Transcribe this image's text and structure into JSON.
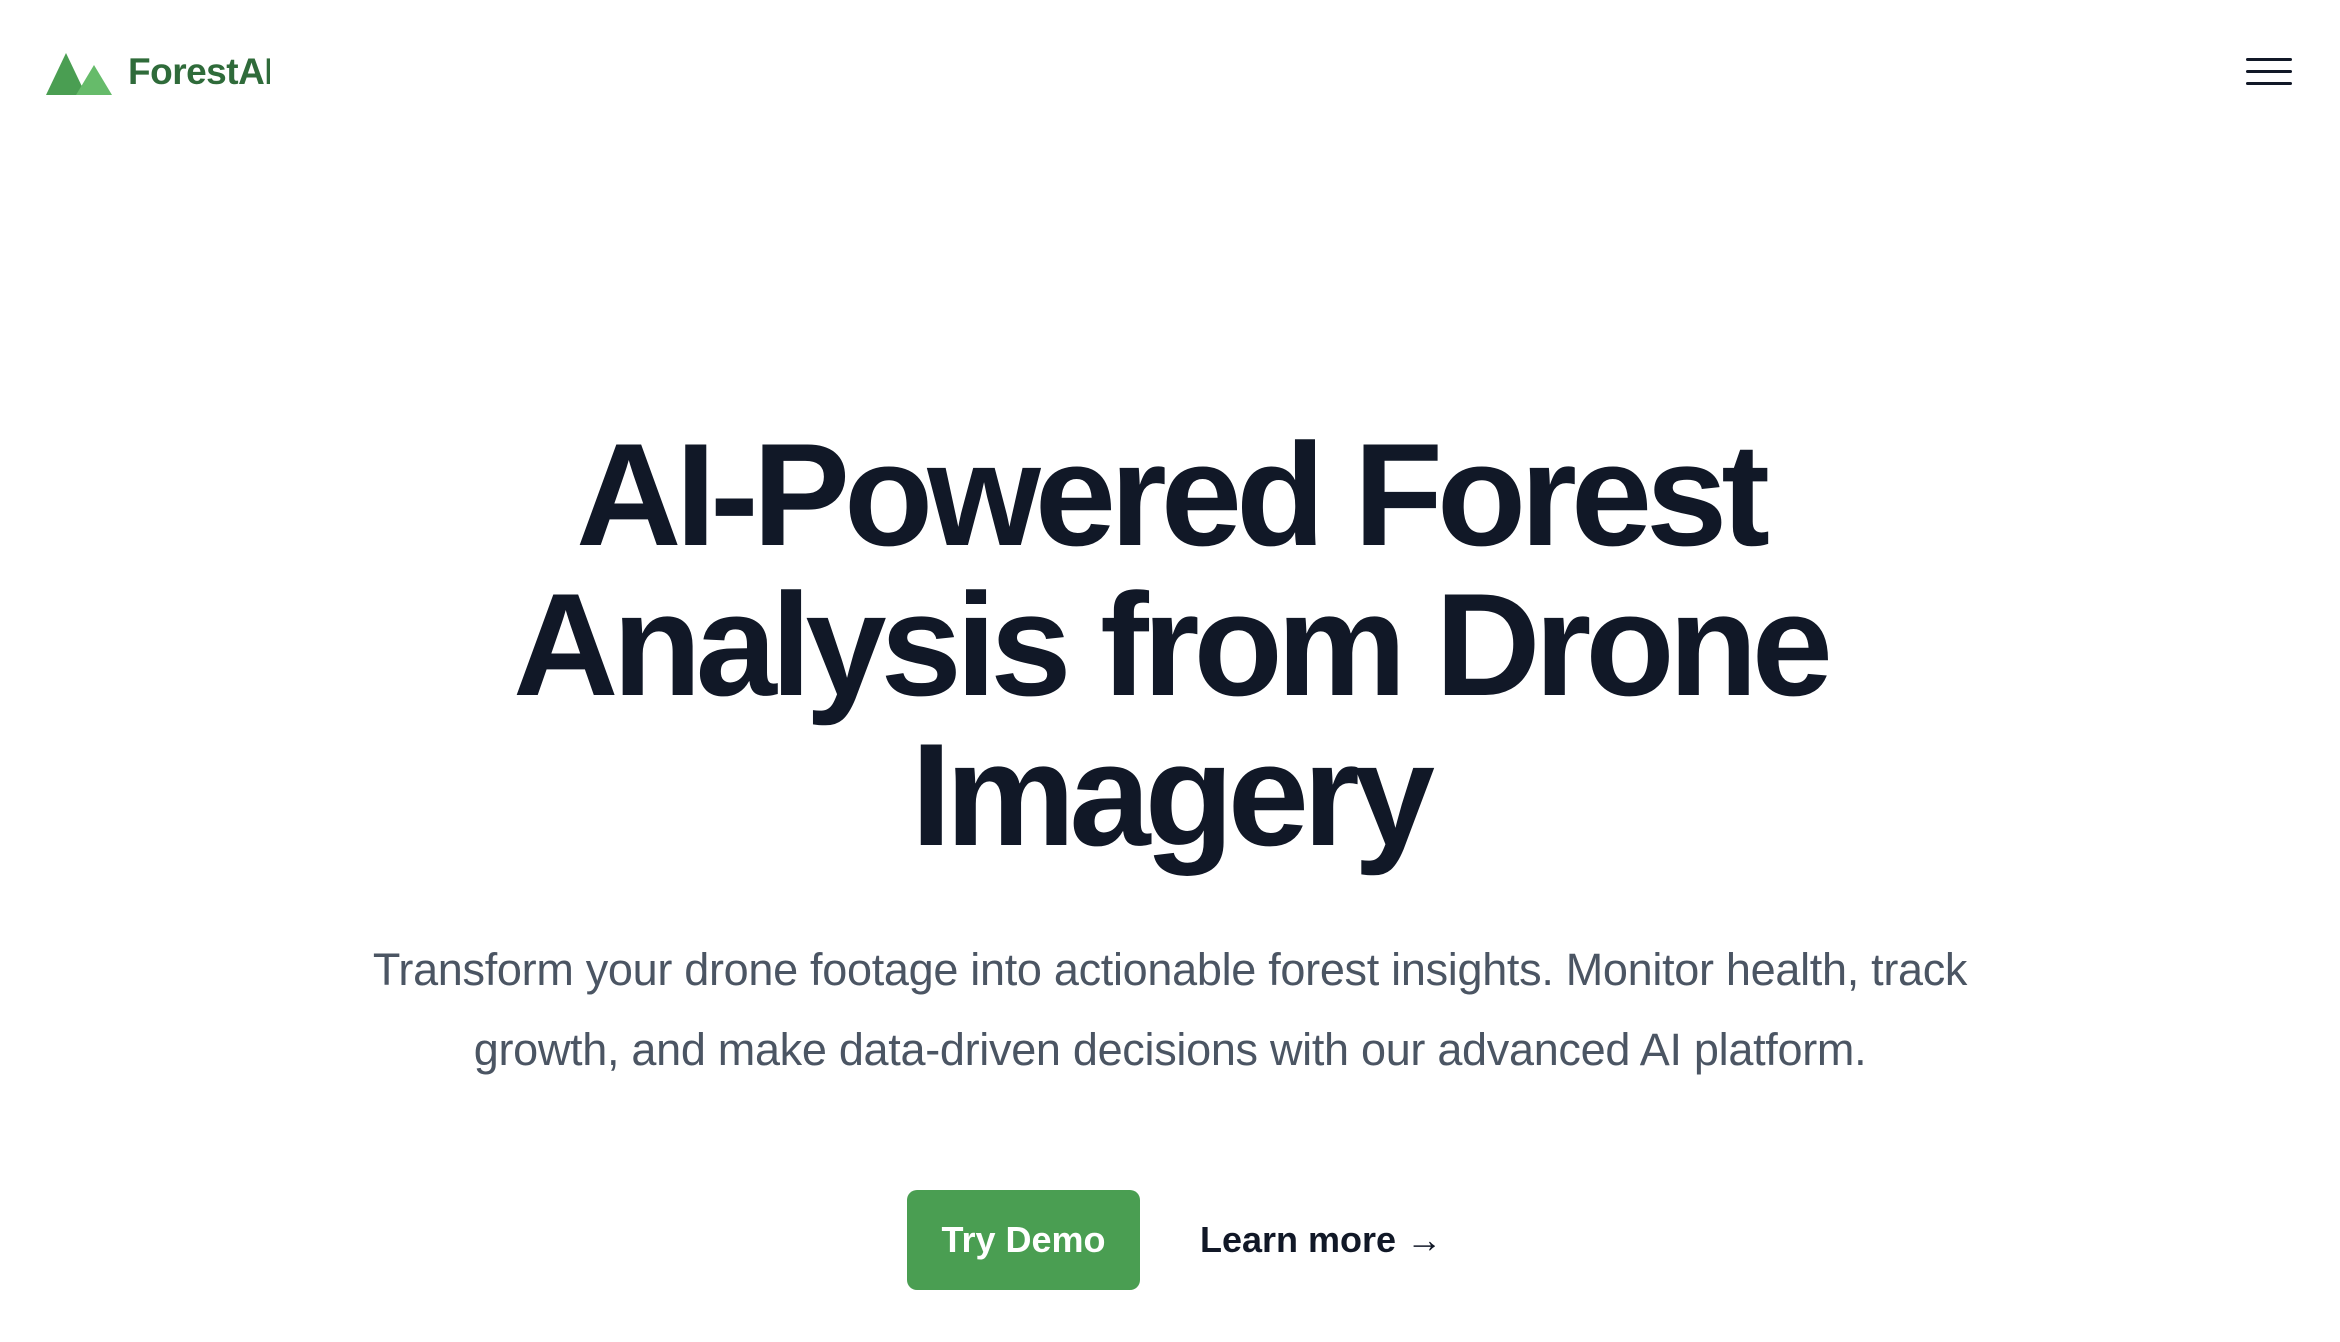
{
  "brand": {
    "name": "ForestAI",
    "logo_icon": "mountain-trees-icon",
    "colors": {
      "primary_green": "#4a9e52",
      "logo_text": "#2f6b3a"
    }
  },
  "nav": {
    "menu_icon": "hamburger-menu-icon"
  },
  "hero": {
    "title": "AI-Powered Forest Analysis from Drone Imagery",
    "subtitle": "Transform your drone footage into actionable forest insights. Monitor health, track growth, and make data-driven decisions with our advanced AI platform.",
    "primary_cta": "Try Demo",
    "secondary_cta": "Learn more",
    "secondary_cta_arrow": "→"
  }
}
